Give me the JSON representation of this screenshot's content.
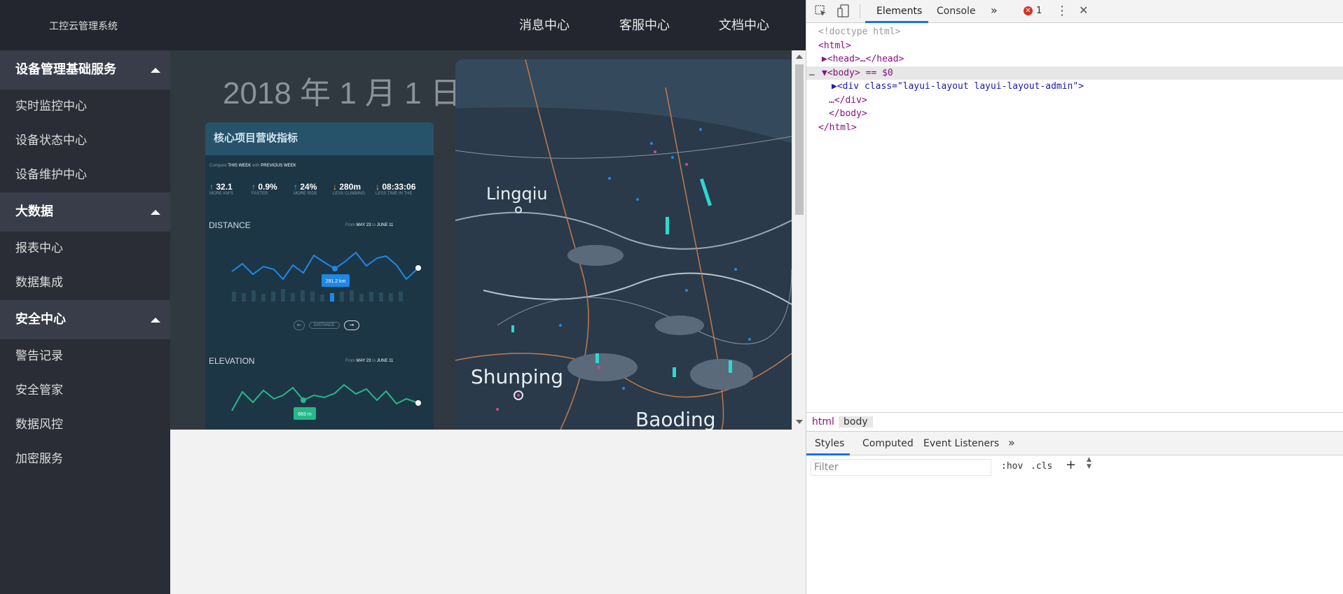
{
  "app": {
    "title": "工控云管理系统",
    "nav": [
      "消息中心",
      "客服中心",
      "文档中心"
    ],
    "sidebar": [
      {
        "label": "设备管理基础服务",
        "items": [
          "实时监控中心",
          "设备状态中心",
          "设备维护中心"
        ]
      },
      {
        "label": "大数据",
        "items": [
          "报表中心",
          "数据集成"
        ]
      },
      {
        "label": "安全中心",
        "items": [
          "警告记录",
          "安全管家",
          "数据风控",
          "加密服务"
        ]
      }
    ]
  },
  "banner": {
    "date": "2018 年 1 月 1 日",
    "card": {
      "title": "核心项目营收指标",
      "compare": {
        "label": "Compare",
        "this": "THIS WEEK",
        "vs": "with",
        "prev": "PREVIOUS WEEK"
      },
      "metrics": [
        {
          "value": "32.1",
          "sub": "MORE KM'S",
          "color": "#26c6da"
        },
        {
          "value": "0.9%",
          "sub": "FASTER",
          "color": "#26c6da"
        },
        {
          "value": "24%",
          "sub": "MORE RIDE",
          "color": "#26c6da"
        },
        {
          "value": "280m",
          "sub": "LESS CLIMBING",
          "color": "#f4c430"
        },
        {
          "value": "08:33:06",
          "sub": "LESS TIME IN THE",
          "color": "#f4c430"
        }
      ],
      "distance": {
        "title": "DISTANCE",
        "from_label": "From",
        "from": "MAY 23",
        "to_label": "to",
        "to": "JUNE 11",
        "tooltip": "291.2 km",
        "pager": "DISTANCE"
      },
      "elevation": {
        "title": "ELEVATION",
        "from_label": "From",
        "from": "MAY 23",
        "to_label": "to",
        "to": "JUNE 11",
        "tooltip": "683 m"
      }
    },
    "map": {
      "labels": [
        "Lingqiu",
        "Shunping",
        "Baoding"
      ]
    }
  },
  "devtools": {
    "tabs": [
      "Elements",
      "Console"
    ],
    "error_count": "1",
    "lines": [
      {
        "text": "<!doctype html>"
      },
      {
        "text": "<html>"
      },
      {
        "text": "▶<head>…</head>"
      },
      {
        "text": "▼<body> == $0"
      },
      {
        "text": "▶<div class=\"layui-layout layui-layout-admin\">"
      },
      {
        "text": "…</div>"
      },
      {
        "text": "</body>"
      },
      {
        "text": "</html>"
      }
    ],
    "breadcrumb": [
      "html",
      "body"
    ],
    "subtabs": [
      "Styles",
      "Computed",
      "Event Listeners"
    ],
    "filter_placeholder": "Filter",
    "hov": ":hov",
    "cls": ".cls"
  }
}
